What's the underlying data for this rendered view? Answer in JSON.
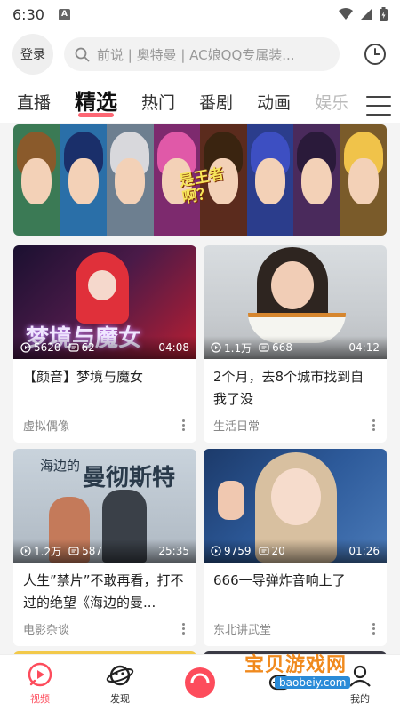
{
  "status": {
    "time": "6:30",
    "notif_badge": "A"
  },
  "header": {
    "login_label": "登录",
    "search_placeholder": "前说 | 奥特曼 | AC娘QQ专属装..."
  },
  "tabs": [
    "直播",
    "精选",
    "热门",
    "番剧",
    "动画",
    "娱乐"
  ],
  "active_tab": "精选",
  "banner": {
    "title": "是王者啊？"
  },
  "cards": [
    {
      "views": "5620",
      "comments": "62",
      "duration": "04:08",
      "title": "【颜音】梦境与魔女",
      "category": "虚拟偶像",
      "thumb_text": "梦境与魔女"
    },
    {
      "views": "1.1万",
      "comments": "668",
      "duration": "04:12",
      "title": "2个月，去8个城市找到自我了没",
      "category": "生活日常"
    },
    {
      "views": "1.2万",
      "comments": "587",
      "duration": "25:35",
      "title": "人生”禁片”不敢再看，打不过的绝望《海边的曼...",
      "category": "电影杂谈",
      "thumb_text": "曼彻斯特",
      "thumb_text_small": "海边的"
    },
    {
      "views": "9759",
      "comments": "20",
      "duration": "01:26",
      "title": "666一导弹炸音响上了",
      "category": "东北讲武堂"
    }
  ],
  "bottom_nav": [
    {
      "label": "视频",
      "icon": "video-icon",
      "active": true
    },
    {
      "label": "发现",
      "icon": "planet-icon",
      "active": false
    },
    {
      "label": "",
      "icon": "center-icon",
      "active": false
    },
    {
      "label": "",
      "icon": "game-icon",
      "active": false
    },
    {
      "label": "我的",
      "icon": "profile-icon",
      "active": false
    }
  ],
  "watermark": {
    "text": "宝贝游戏网",
    "url": "baobeiy.com"
  },
  "colors": {
    "accent": "#fd4c5c"
  }
}
